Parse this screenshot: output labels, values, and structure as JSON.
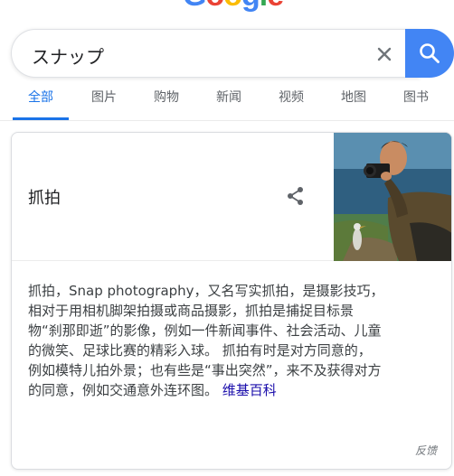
{
  "logo": {
    "letters": [
      "G",
      "o",
      "o",
      "g",
      "l",
      "e"
    ]
  },
  "search": {
    "query": "スナップ"
  },
  "tabs": [
    {
      "label": "全部",
      "active": true
    },
    {
      "label": "图片"
    },
    {
      "label": "购物"
    },
    {
      "label": "新闻"
    },
    {
      "label": "视频"
    },
    {
      "label": "地图"
    },
    {
      "label": "图书"
    }
  ],
  "card": {
    "title": "抓拍",
    "description_lines": [
      "抓拍，Snap photography，又名写实抓拍，是摄影技巧，",
      "相对于用相机脚架拍摄或商品摄影，抓拍是捕捉目标景",
      "物“刹那即逝”的影像，例如一件新闻事件、社会活动、儿童",
      "的微笑、足球比赛的精彩入球。 抓拍有时是对方同意的，",
      "例如模特儿拍外景；也有些是“事出突然”，来不及获得对方",
      "的同意，例如交通意外连环图。"
    ],
    "source_link": "维基百科",
    "feedback": "反馈"
  },
  "colors": {
    "accent": "#1a73e8",
    "search_button": "#4285f4",
    "link": "#1a0dab"
  }
}
